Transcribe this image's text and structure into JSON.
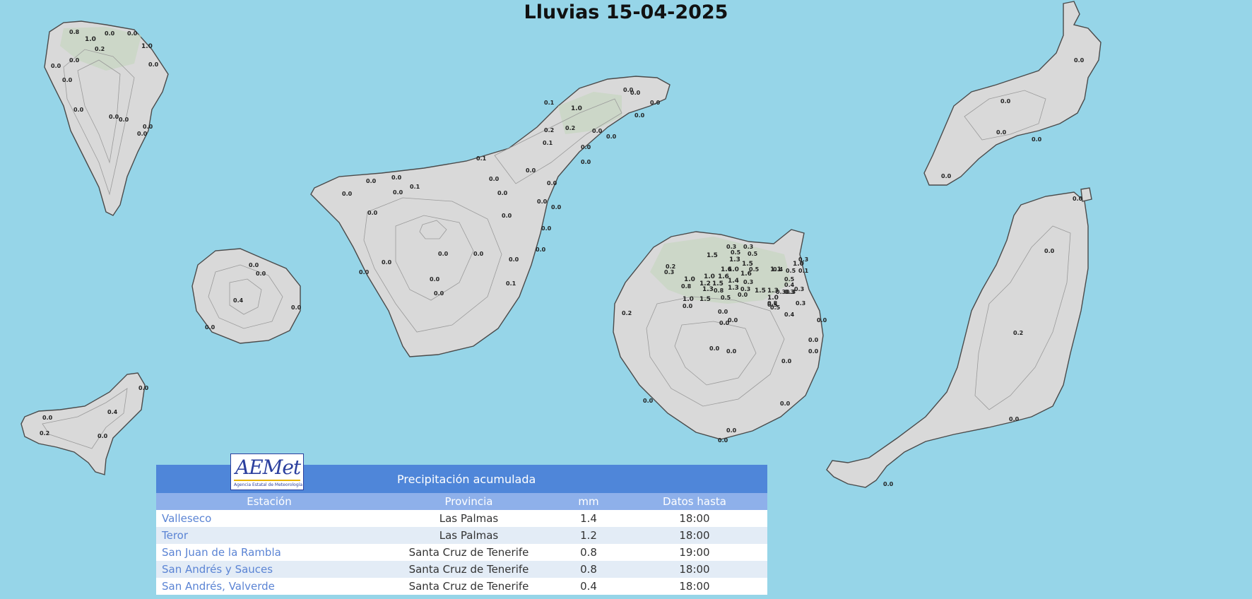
{
  "title": "Lluvias 15-04-2025",
  "colors": {
    "sea": "#96d5e8",
    "land": "#d9d9d9",
    "header": "#4f86d9",
    "subheader": "#8eb0ea",
    "station_link": "#5b84d4"
  },
  "logo": {
    "text": "AEMet",
    "subtitle": "Agencia Estatal de Meteorología"
  },
  "table": {
    "header": "Precipitación acumulada",
    "columns": [
      "Estación",
      "Provincia",
      "mm",
      "Datos hasta"
    ],
    "rows": [
      {
        "station": "Valleseco",
        "province": "Las Palmas",
        "mm": "1.4",
        "time": "18:00"
      },
      {
        "station": "Teror",
        "province": "Las Palmas",
        "mm": "1.2",
        "time": "18:00"
      },
      {
        "station": "San Juan de la Rambla",
        "province": "Santa Cruz de Tenerife",
        "mm": "0.8",
        "time": "19:00"
      },
      {
        "station": "San Andrés y Sauces",
        "province": "Santa Cruz de Tenerife",
        "mm": "0.8",
        "time": "18:00"
      },
      {
        "station": "San Andrés, Valverde",
        "province": "Santa Cruz de Tenerife",
        "mm": "0.4",
        "time": "18:00"
      }
    ]
  },
  "map_labels": {
    "la_palma": [
      "0.8",
      "1.0",
      "0.0",
      "0.0",
      "1.0",
      "0.2",
      "0.0",
      "0.0",
      "0.0",
      "0.0",
      "0.0",
      "0.0",
      "0.0",
      "0.0",
      "0.0"
    ],
    "la_gomera": [
      "0.0",
      "0.0",
      "0.4",
      "0.0",
      "0.0"
    ],
    "el_hierro": [
      "0.0",
      "0.0",
      "0.4",
      "0.2",
      "0.0"
    ],
    "tenerife": [
      "0.1",
      "1.0",
      "0.0",
      "0.0",
      "0.0",
      "0.0",
      "0.2",
      "0.2",
      "0.0",
      "0.0",
      "0.1",
      "0.0",
      "0.0",
      "0.1",
      "0.0",
      "0.0",
      "0.1",
      "0.0",
      "0.0",
      "0.0",
      "0.0",
      "0.0",
      "0.0",
      "0.0",
      "0.0",
      "0.0",
      "0.0",
      "0.0",
      "0.0",
      "0.0",
      "0.0",
      "0.0",
      "0.0",
      "0.0",
      "0.0",
      "0.1",
      "0.0"
    ],
    "gran_canaria": [
      "0.3",
      "0.3",
      "1.5",
      "0.5",
      "0.5",
      "1.3",
      "1.5",
      "1.6",
      "0.5",
      "1.0",
      "0.2",
      "0.3",
      "0.4",
      "1.6",
      "1.0",
      "1.6",
      "1.1",
      "0.3",
      "0.0",
      "1.0",
      "1.2",
      "1.5",
      "1.4",
      "0.3",
      "0.5",
      "0.1",
      "0.8",
      "1.3",
      "0.8",
      "1.3",
      "1.5",
      "0.4",
      "0.5",
      "1.0",
      "0.3",
      "1.0",
      "1.5",
      "0.5",
      "1.3",
      "1.0",
      "0.3",
      "0.3",
      "0.8",
      "0.3",
      "0.5",
      "0.3",
      "0.5",
      "0.3",
      "0.2",
      "0.0",
      "0.4",
      "0.0",
      "0.0",
      "0.0",
      "0.0",
      "0.0",
      "0.0",
      "0.0",
      "0.0",
      "0.0",
      "0.0",
      "0.0",
      "0.0",
      "0.0"
    ],
    "lanzarote": [
      "0.0",
      "0.0",
      "0.0",
      "0.0",
      "0.0"
    ],
    "fuerteventura": [
      "0.0",
      "0.0",
      "0.2",
      "0.0",
      "0.0"
    ]
  }
}
